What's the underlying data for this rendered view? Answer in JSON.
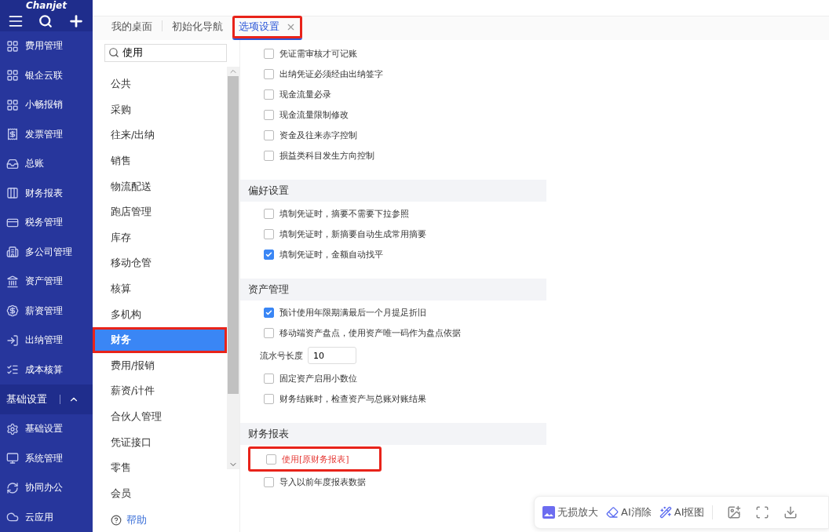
{
  "logo": "Chanjet",
  "sidebar": {
    "items": [
      {
        "label": "费用管理"
      },
      {
        "label": "银企云联"
      },
      {
        "label": "小畅报销"
      },
      {
        "label": "发票管理"
      },
      {
        "label": "总账"
      },
      {
        "label": "财务报表"
      },
      {
        "label": "税务管理"
      },
      {
        "label": "多公司管理"
      },
      {
        "label": "资产管理"
      },
      {
        "label": "薪资管理"
      },
      {
        "label": "出纳管理"
      },
      {
        "label": "成本核算"
      }
    ],
    "group": {
      "label": "基础设置",
      "expanded": true,
      "items": [
        {
          "label": "基础设置"
        },
        {
          "label": "系统管理"
        },
        {
          "label": "协同办公"
        },
        {
          "label": "云应用"
        }
      ]
    }
  },
  "tabs": [
    {
      "label": "我的桌面",
      "selected": false,
      "highlighted": false
    },
    {
      "label": "初始化导航",
      "selected": false,
      "highlighted": false
    },
    {
      "label": "选项设置",
      "selected": true,
      "highlighted": true
    }
  ],
  "search": {
    "value": "使用"
  },
  "categories": [
    {
      "label": "公共",
      "selected": false,
      "highlighted": false
    },
    {
      "label": "采购",
      "selected": false,
      "highlighted": false
    },
    {
      "label": "往来/出纳",
      "selected": false,
      "highlighted": false
    },
    {
      "label": "销售",
      "selected": false,
      "highlighted": false
    },
    {
      "label": "物流配送",
      "selected": false,
      "highlighted": false
    },
    {
      "label": "跑店管理",
      "selected": false,
      "highlighted": false
    },
    {
      "label": "库存",
      "selected": false,
      "highlighted": false
    },
    {
      "label": "移动仓管",
      "selected": false,
      "highlighted": false
    },
    {
      "label": "核算",
      "selected": false,
      "highlighted": false
    },
    {
      "label": "多机构",
      "selected": false,
      "highlighted": false
    },
    {
      "label": "财务",
      "selected": true,
      "highlighted": true
    },
    {
      "label": "费用/报销",
      "selected": false,
      "highlighted": false
    },
    {
      "label": "薪资/计件",
      "selected": false,
      "highlighted": false
    },
    {
      "label": "合伙人管理",
      "selected": false,
      "highlighted": false
    },
    {
      "label": "凭证接口",
      "selected": false,
      "highlighted": false
    },
    {
      "label": "零售",
      "selected": false,
      "highlighted": false
    },
    {
      "label": "会员",
      "selected": false,
      "highlighted": false
    }
  ],
  "help": "帮助",
  "sections": [
    {
      "options": [
        {
          "kind": "checkbox",
          "label": "凭证需审核才可记账",
          "checked": false
        },
        {
          "kind": "checkbox",
          "label": "出纳凭证必须经由出纳签字",
          "checked": false
        },
        {
          "kind": "checkbox",
          "label": "现金流量必录",
          "checked": false
        },
        {
          "kind": "checkbox",
          "label": "现金流量限制修改",
          "checked": false
        },
        {
          "kind": "checkbox",
          "label": "资金及往来赤字控制",
          "checked": false
        },
        {
          "kind": "checkbox",
          "label": "损益类科目发生方向控制",
          "checked": false
        }
      ]
    },
    {
      "title": "偏好设置",
      "options": [
        {
          "kind": "checkbox",
          "label": "填制凭证时，摘要不需要下拉参照",
          "checked": false
        },
        {
          "kind": "checkbox",
          "label": "填制凭证时，新摘要自动生成常用摘要",
          "checked": false
        },
        {
          "kind": "checkbox",
          "label": "填制凭证时，金额自动找平",
          "checked": true
        }
      ]
    },
    {
      "title": "资产管理",
      "options": [
        {
          "kind": "checkbox",
          "label": "预计使用年限期满最后一个月提足折旧",
          "checked": true
        },
        {
          "kind": "checkbox",
          "label": "移动端资产盘点，使用资产唯一码作为盘点依据",
          "checked": false
        },
        {
          "kind": "number",
          "label": "流水号长度",
          "value": "10"
        },
        {
          "kind": "checkbox",
          "label": "固定资产启用小数位",
          "checked": false
        },
        {
          "kind": "checkbox",
          "label": "财务结账时，检查资产与总账对账结果",
          "checked": false
        }
      ]
    },
    {
      "title": "财务报表",
      "options": [
        {
          "kind": "checkbox",
          "label": "使用[原财务报表]",
          "checked": false,
          "highlighted": true,
          "color": "#e53935"
        },
        {
          "kind": "checkbox",
          "label": "导入以前年度报表数据",
          "checked": false
        }
      ]
    }
  ],
  "image_toolbar": [
    {
      "label": "无损放大"
    },
    {
      "label": "AI消除"
    },
    {
      "label": "AI抠图"
    }
  ]
}
